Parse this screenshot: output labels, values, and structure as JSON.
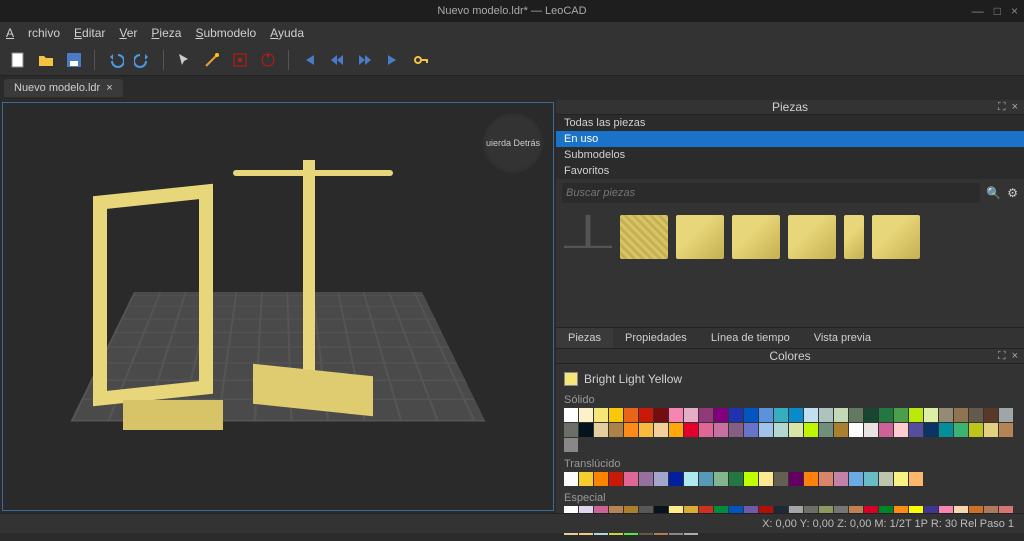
{
  "titlebar": {
    "title": "Nuevo modelo.ldr* — LeoCAD"
  },
  "menu": {
    "items": [
      "Archivo",
      "Editar",
      "Ver",
      "Pieza",
      "Submodelo",
      "Ayuda"
    ]
  },
  "tabs": {
    "model_tab": "Nuevo modelo.ldr"
  },
  "viewcube": {
    "left": "uierda",
    "back": "Detrás"
  },
  "panel": {
    "pieces_title": "Piezas",
    "filters": {
      "all": "Todas las piezas",
      "inuse": "En uso",
      "sub": "Submodelos",
      "fav": "Favoritos"
    },
    "search_placeholder": "Buscar piezas",
    "tabs": {
      "pieces": "Piezas",
      "props": "Propiedades",
      "timeline": "Línea de tiempo",
      "preview": "Vista previa"
    },
    "colors_title": "Colores",
    "current_color": "Bright Light Yellow",
    "group_solid": "Sólido",
    "group_trans": "Translúcido",
    "group_special": "Especial"
  },
  "status": {
    "text": "X: 0,00 Y: 0,00 Z: 0,00   M: 1/2T 1P R: 30 Rel   Paso 1"
  },
  "colors_solid": [
    "#ffffff",
    "#fef0c9",
    "#f5e67a",
    "#fac80a",
    "#e76419",
    "#c91a09",
    "#720e0f",
    "#f785b1",
    "#e4adc8",
    "#923978",
    "#81007b",
    "#2032b0",
    "#0055bf",
    "#5a93db",
    "#36aebf",
    "#078bc9",
    "#c1dff0",
    "#adc3c0",
    "#c2dab8",
    "#627a62",
    "#184632",
    "#237841",
    "#4b9f4a",
    "#bbe90b",
    "#dfeea5",
    "#958a73",
    "#907450",
    "#645a4c",
    "#583927",
    "#a0a5a9",
    "#6c6e68",
    "#05131d",
    "#e4cd9e",
    "#ac8247",
    "#fe8a18",
    "#f8bb3d",
    "#f3cf9b",
    "#ffa70b",
    "#e4002b",
    "#df6695",
    "#c870a0",
    "#845e84",
    "#6874ca",
    "#9fc3e9",
    "#b3d7d1",
    "#d9e4a7",
    "#c0f500",
    "#708e7c",
    "#aa7f2e",
    "#fcfcfc",
    "#e6e3e0",
    "#cd6298",
    "#fecccf",
    "#564e9d",
    "#0a3463",
    "#008f9b",
    "#3cb371",
    "#bdc618",
    "#e0d080",
    "#b48455",
    "#898788"
  ],
  "colors_trans": [
    "#fcfcfc",
    "#f5cd2f",
    "#fc8500",
    "#c91a09",
    "#df6695",
    "#96709f",
    "#a5a5cb",
    "#0020a0",
    "#aee9ef",
    "#559ab7",
    "#84b68d",
    "#237841",
    "#c0ff00",
    "#fbe890",
    "#635f52",
    "#640061",
    "#ff800d",
    "#d9856c",
    "#c281a5",
    "#6babe4",
    "#68bcc5",
    "#bdc6ad",
    "#f8f184",
    "#fcb76d"
  ],
  "colors_special": [
    "#ffffff",
    "#e1d5ed",
    "#cd6298",
    "#b48455",
    "#aa7f2e",
    "#575857",
    "#05131d",
    "#fdea8c",
    "#dbac34",
    "#ce3021",
    "#008e3c",
    "#0055bf",
    "#6e5aa8",
    "#b31004",
    "#1b2a34",
    "#a5a5a9",
    "#6c6e68",
    "#899b5f",
    "#767676",
    "#c27f53",
    "#d60026",
    "#00852b",
    "#fe8a18",
    "#fcfc00",
    "#3f3691",
    "#f785b1",
    "#f6d7b3",
    "#cc702a",
    "#ae7a59",
    "#d67572",
    "#e4cd9e",
    "#f3c988",
    "#b4d2e3",
    "#c7d23c",
    "#56e646",
    "#645a4c",
    "#b67b50",
    "#898788",
    "#abadac"
  ]
}
